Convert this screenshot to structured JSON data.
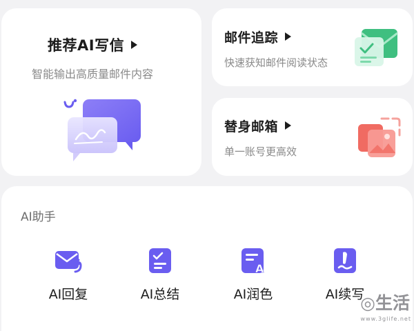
{
  "cards": {
    "ai_write": {
      "title": "推荐AI写信",
      "subtitle": "智能输出高质量邮件内容"
    },
    "mail_tracking": {
      "title": "邮件追踪",
      "subtitle": "快速获知邮件阅读状态"
    },
    "alias_mailbox": {
      "title": "替身邮箱",
      "subtitle": "单一账号更高效"
    }
  },
  "ai_assistant": {
    "title": "AI助手",
    "tools": [
      {
        "label": "AI回复",
        "icon": "reply-mail-icon"
      },
      {
        "label": "AI总结",
        "icon": "summary-list-icon"
      },
      {
        "label": "AI润色",
        "icon": "polish-text-icon"
      },
      {
        "label": "AI续写",
        "icon": "continue-writing-icon"
      }
    ]
  },
  "colors": {
    "accent_purple": "#6a5df0",
    "track_green": "#4cc98c",
    "alias_red": "#f06b62"
  }
}
